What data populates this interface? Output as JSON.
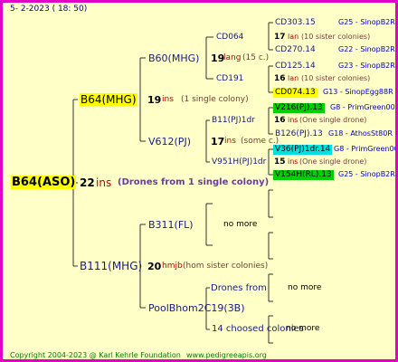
{
  "header": {
    "date": "5-  2-2023 ( 18:  50)"
  },
  "footer": {
    "copyright": "Copyright 2004-2023 @ Karl Kehrle Foundation",
    "site": "www.pedigreeapis.org"
  },
  "colors": {
    "frame": "#e000c8",
    "background": "#ffffc8",
    "highlight_yellow": "#ffff00",
    "highlight_green": "#00d000",
    "highlight_cyan": "#00e0e0"
  },
  "queen": {
    "name": "B64(ASO)",
    "gen_number": "22",
    "gen_suffix": "ins",
    "note": "(Drones from 1 single colony)"
  },
  "dam": {
    "name": "B64(MHG)",
    "gen_number": "19",
    "gen_suffix": "ins",
    "note": "(1 single colony)"
  },
  "sire": {
    "name": "B111(MHG)",
    "gen_number": "20",
    "gen_suffix": "hmjb",
    "note": "(hom sister colonies)"
  },
  "dd": {
    "name": "B60(MHG)",
    "gen_number": "19",
    "gen_suffix": "lang",
    "note": "(15 c.)"
  },
  "ds": {
    "name": "V612(PJ)",
    "gen_number": "17",
    "gen_suffix": "ins",
    "note": "(some c.)"
  },
  "ddd": {
    "name": "CD064",
    "gen_number": "17",
    "gen_suffix": "lan",
    "note": "(10 sister colonies)"
  },
  "dds": {
    "name": "CD191",
    "gen_number": "16",
    "gen_suffix": "lan",
    "note": "(10 sister colonies)"
  },
  "dsd": {
    "name": "B11(PJ)1dr",
    "gen_number": "16",
    "gen_suffix": "ins",
    "note": "(One single drone)"
  },
  "dss": {
    "name": "V951H(PJ)1dr",
    "gen_number": "15",
    "gen_suffix": "ins",
    "note": "(One single drone)"
  },
  "g4": [
    {
      "name": "CD303.15",
      "ref": "G25 - SinopB2R"
    },
    {
      "name": "CD270.14",
      "ref": "G22 - SinopB2R"
    },
    {
      "name": "CD125.14",
      "ref": "G23 - SinopB2R"
    },
    {
      "name": "CD074.13",
      "ref": "G13 - SinopEgg88R"
    },
    {
      "name": "V216(PJ).13",
      "ref": "G8 - PrimGreen00"
    },
    {
      "name": "B126(PJ).13",
      "ref": "G18 - AthosSt80R"
    },
    {
      "name": "V36(PJ)1dr.14",
      "ref": "G8 - PrimGreen00"
    },
    {
      "name": "V154H(RL).13",
      "ref": "G25 - SinopB2R"
    }
  ],
  "sd": {
    "name": "B311(FL)",
    "more": "no more"
  },
  "ss": {
    "name": "PoolBhom2C19(3B)"
  },
  "ssd": {
    "name": "Drones from",
    "more": "no more"
  },
  "sss": {
    "name": "14 choosed colonies",
    "more": "no more"
  }
}
